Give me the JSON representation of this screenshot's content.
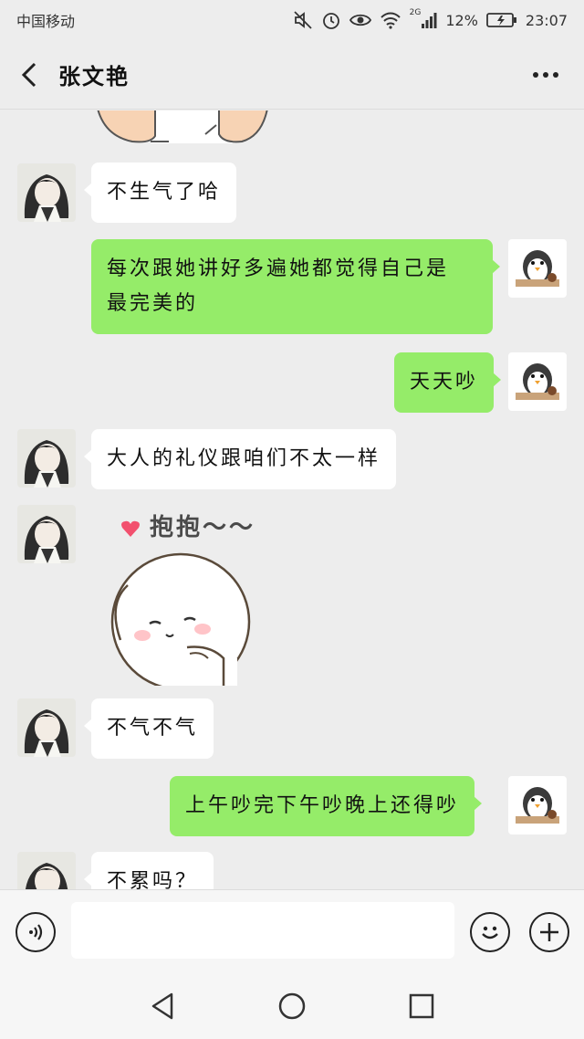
{
  "status_bar": {
    "carrier": "中国移动",
    "network": "2G",
    "battery": "12%",
    "time": "23:07",
    "icons": [
      "mute-icon",
      "alarm-icon",
      "eye-icon",
      "wifi-icon",
      "signal-icon",
      "battery-icon"
    ]
  },
  "header": {
    "title": "张文艳",
    "back_icon": "chevron-left-icon",
    "more_icon": "more-icon"
  },
  "messages": [
    {
      "side": "left",
      "type": "sticker",
      "sticker": "partial-hands-sticker"
    },
    {
      "side": "left",
      "type": "text",
      "text": "不生气了哈"
    },
    {
      "side": "right",
      "type": "text",
      "lines": [
        "每次跟她讲好多遍她都觉得自己是",
        "最完美的"
      ]
    },
    {
      "side": "right",
      "type": "text",
      "text": "天天吵"
    },
    {
      "side": "left",
      "type": "text",
      "text": "大人的礼仪跟咱们不太一样"
    },
    {
      "side": "left",
      "type": "sticker",
      "sticker_text": "抱抱～～"
    },
    {
      "side": "left",
      "type": "text",
      "text": "不气不气"
    },
    {
      "side": "right",
      "type": "text",
      "text": "上午吵完下午吵晚上还得吵"
    },
    {
      "side": "left",
      "type": "text",
      "text": "不累吗？"
    }
  ],
  "input_bar": {
    "voice_icon": "voice-icon",
    "emoji_icon": "emoji-icon",
    "add_icon": "add-icon",
    "input_value": ""
  },
  "nav_bar": {
    "icons": [
      "back-triangle-icon",
      "home-circle-icon",
      "recents-square-icon"
    ]
  },
  "colors": {
    "background": "#ededed",
    "sent_bubble": "#95ec69",
    "received_bubble": "#ffffff"
  }
}
